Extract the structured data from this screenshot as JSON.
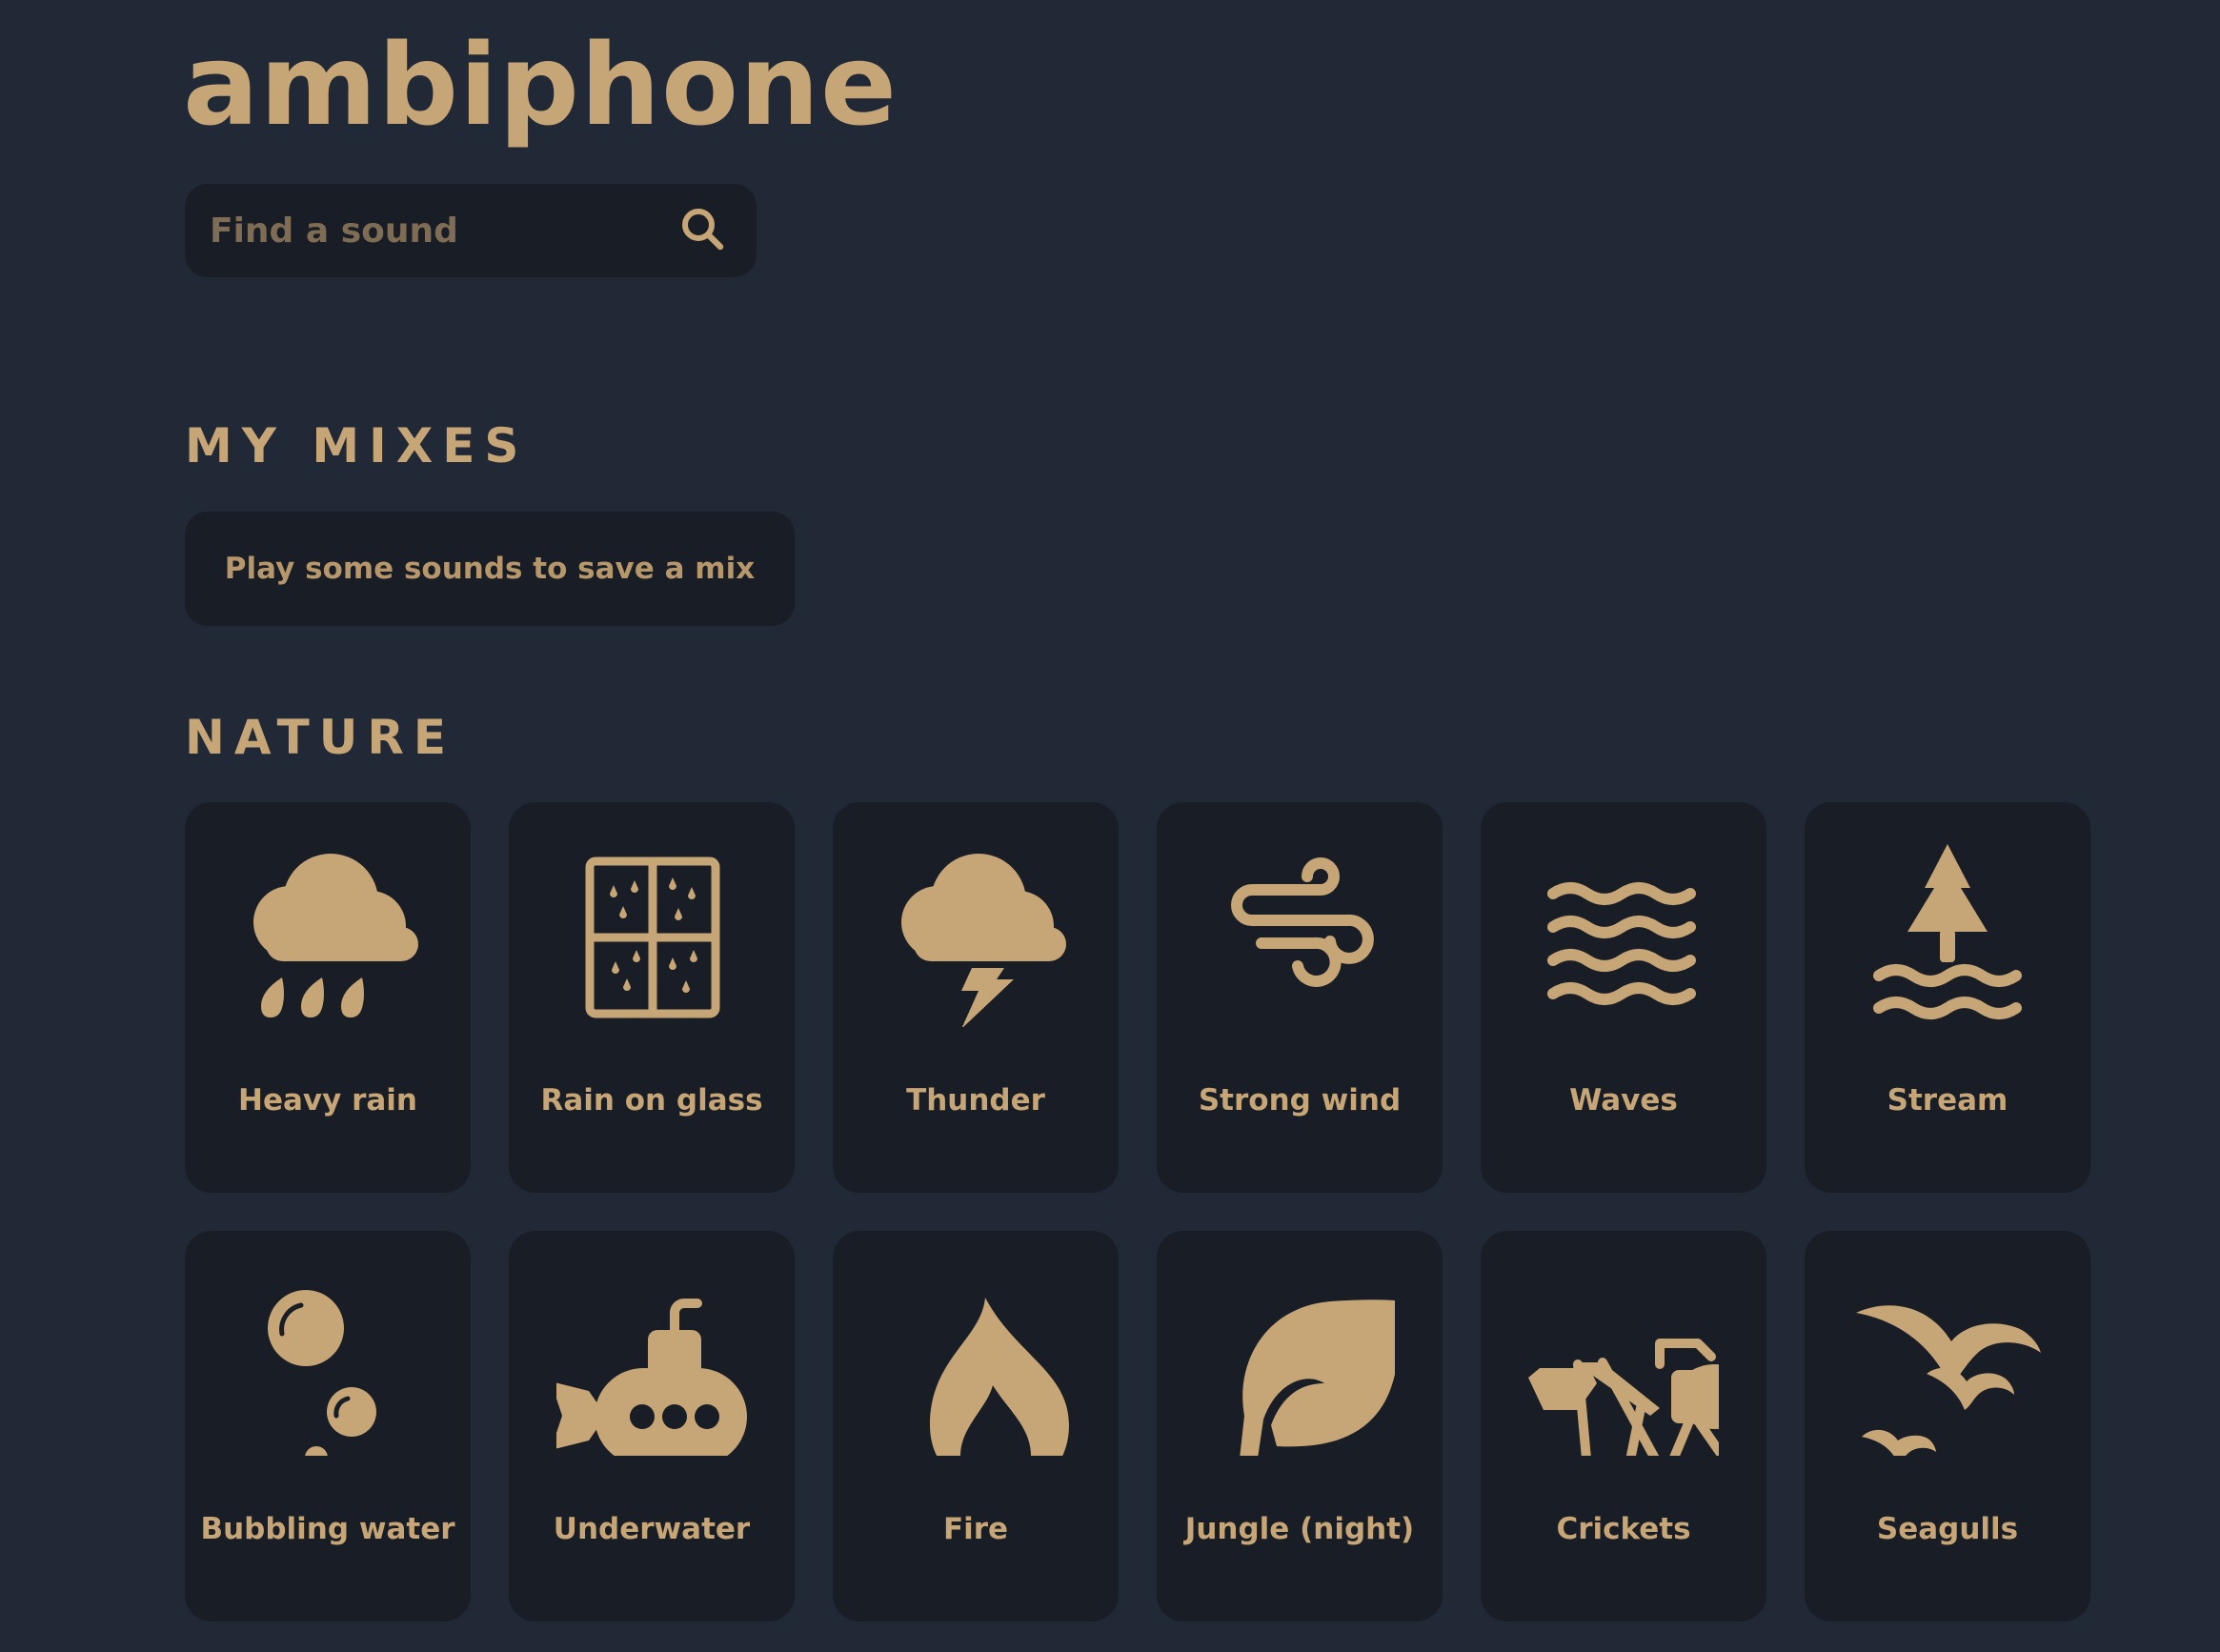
{
  "app": {
    "title": "ambiphone"
  },
  "search": {
    "placeholder": "Find a sound",
    "value": "",
    "icon": "search-icon"
  },
  "mixes": {
    "heading": "MY MIXES",
    "empty_text": "Play some sounds to save a mix"
  },
  "nature": {
    "heading": "NATURE",
    "sounds": [
      {
        "label": "Heavy rain",
        "icon": "heavy-rain-icon"
      },
      {
        "label": "Rain on glass",
        "icon": "window-rain-icon"
      },
      {
        "label": "Thunder",
        "icon": "thunder-icon"
      },
      {
        "label": "Strong wind",
        "icon": "wind-icon"
      },
      {
        "label": "Waves",
        "icon": "waves-icon"
      },
      {
        "label": "Stream",
        "icon": "stream-icon"
      },
      {
        "label": "Bubbling water",
        "icon": "bubbles-icon"
      },
      {
        "label": "Underwater",
        "icon": "submarine-icon"
      },
      {
        "label": "Fire",
        "icon": "fire-icon"
      },
      {
        "label": "Jungle (night)",
        "icon": "leaf-icon"
      },
      {
        "label": "Crickets",
        "icon": "cricket-icon"
      },
      {
        "label": "Seagulls",
        "icon": "seagulls-icon"
      }
    ]
  },
  "colors": {
    "background": "#212836",
    "card": "#191d25",
    "accent": "#c6a577"
  }
}
